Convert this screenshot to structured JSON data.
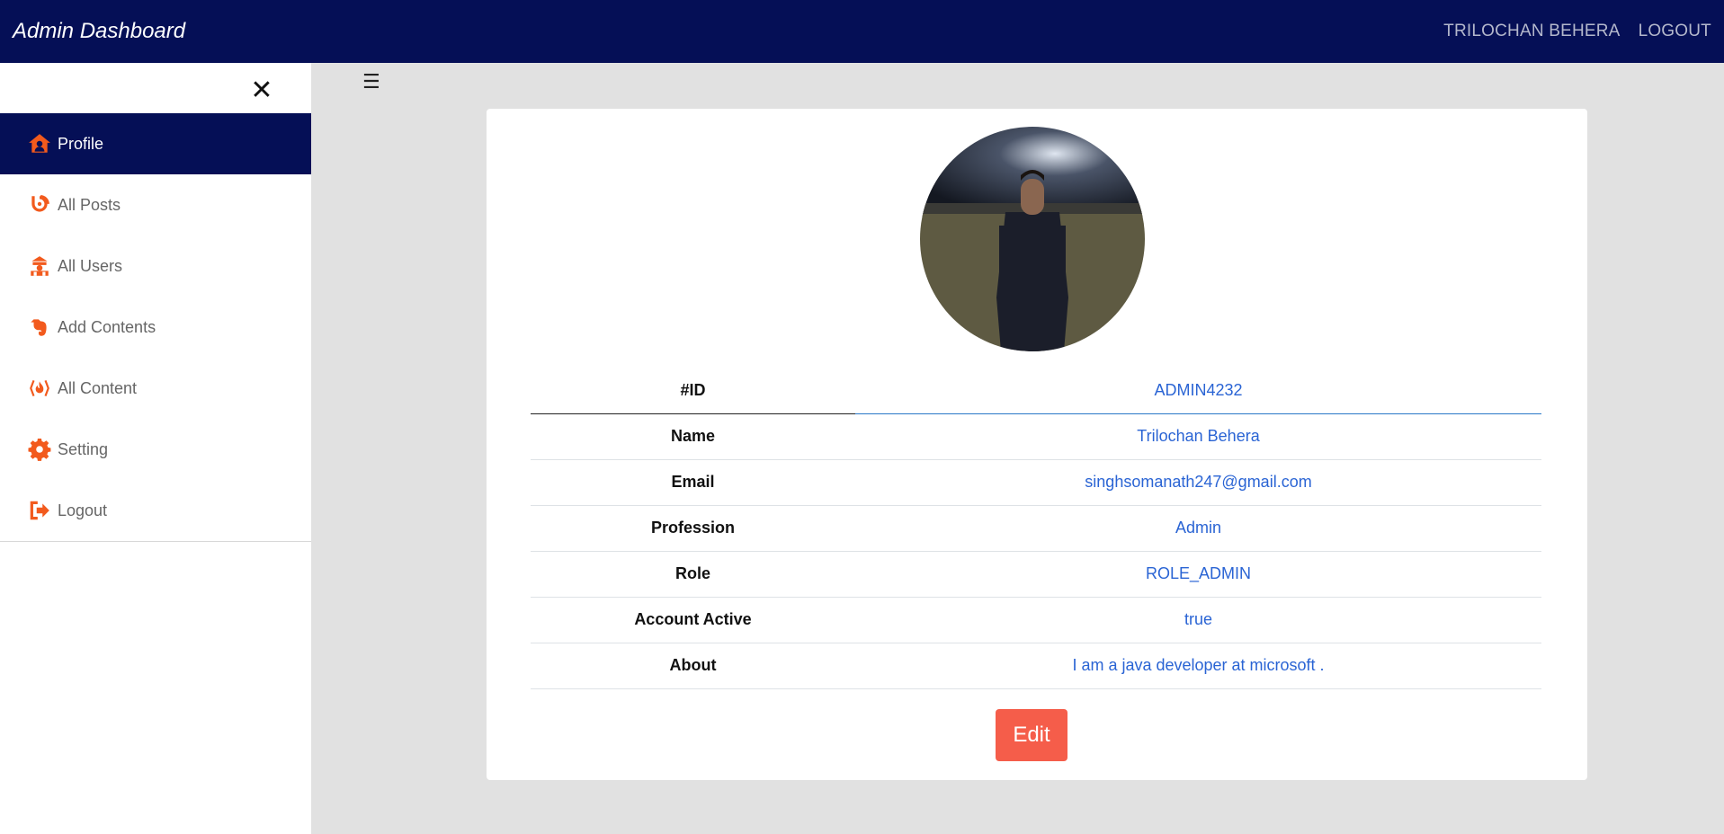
{
  "header": {
    "brand": "Admin Dashboard",
    "user_name": "TRILOCHAN BEHERA",
    "logout": "LOGOUT"
  },
  "sidebar": {
    "close_icon": "close-icon",
    "items": [
      {
        "label": "Profile",
        "icon": "home-user-icon",
        "active": true
      },
      {
        "label": "All Posts",
        "icon": "blogger-icon",
        "active": false
      },
      {
        "label": "All Users",
        "icon": "users-icon",
        "active": false
      },
      {
        "label": "Add Contents",
        "icon": "evernote-icon",
        "active": false
      },
      {
        "label": "All Content",
        "icon": "fire-code-icon",
        "active": false
      },
      {
        "label": "Setting",
        "icon": "gear-icon",
        "active": false
      },
      {
        "label": "Logout",
        "icon": "sign-out-icon",
        "active": false
      }
    ]
  },
  "main": {
    "menu_icon": "hamburger-icon",
    "profile": {
      "rows": [
        {
          "key": "#ID",
          "value": "ADMIN4232"
        },
        {
          "key": "Name",
          "value": "Trilochan Behera"
        },
        {
          "key": "Email",
          "value": "singhsomanath247@gmail.com"
        },
        {
          "key": "Profession",
          "value": "Admin"
        },
        {
          "key": "Role",
          "value": "ROLE_ADMIN"
        },
        {
          "key": "Account Active",
          "value": "true"
        },
        {
          "key": "About",
          "value": "I am a java developer at microsoft ."
        }
      ],
      "edit_label": "Edit"
    }
  },
  "colors": {
    "navbar": "#050f56",
    "accent": "#f25a1d",
    "link": "#2a64d4",
    "edit_button": "#f55d4a"
  }
}
